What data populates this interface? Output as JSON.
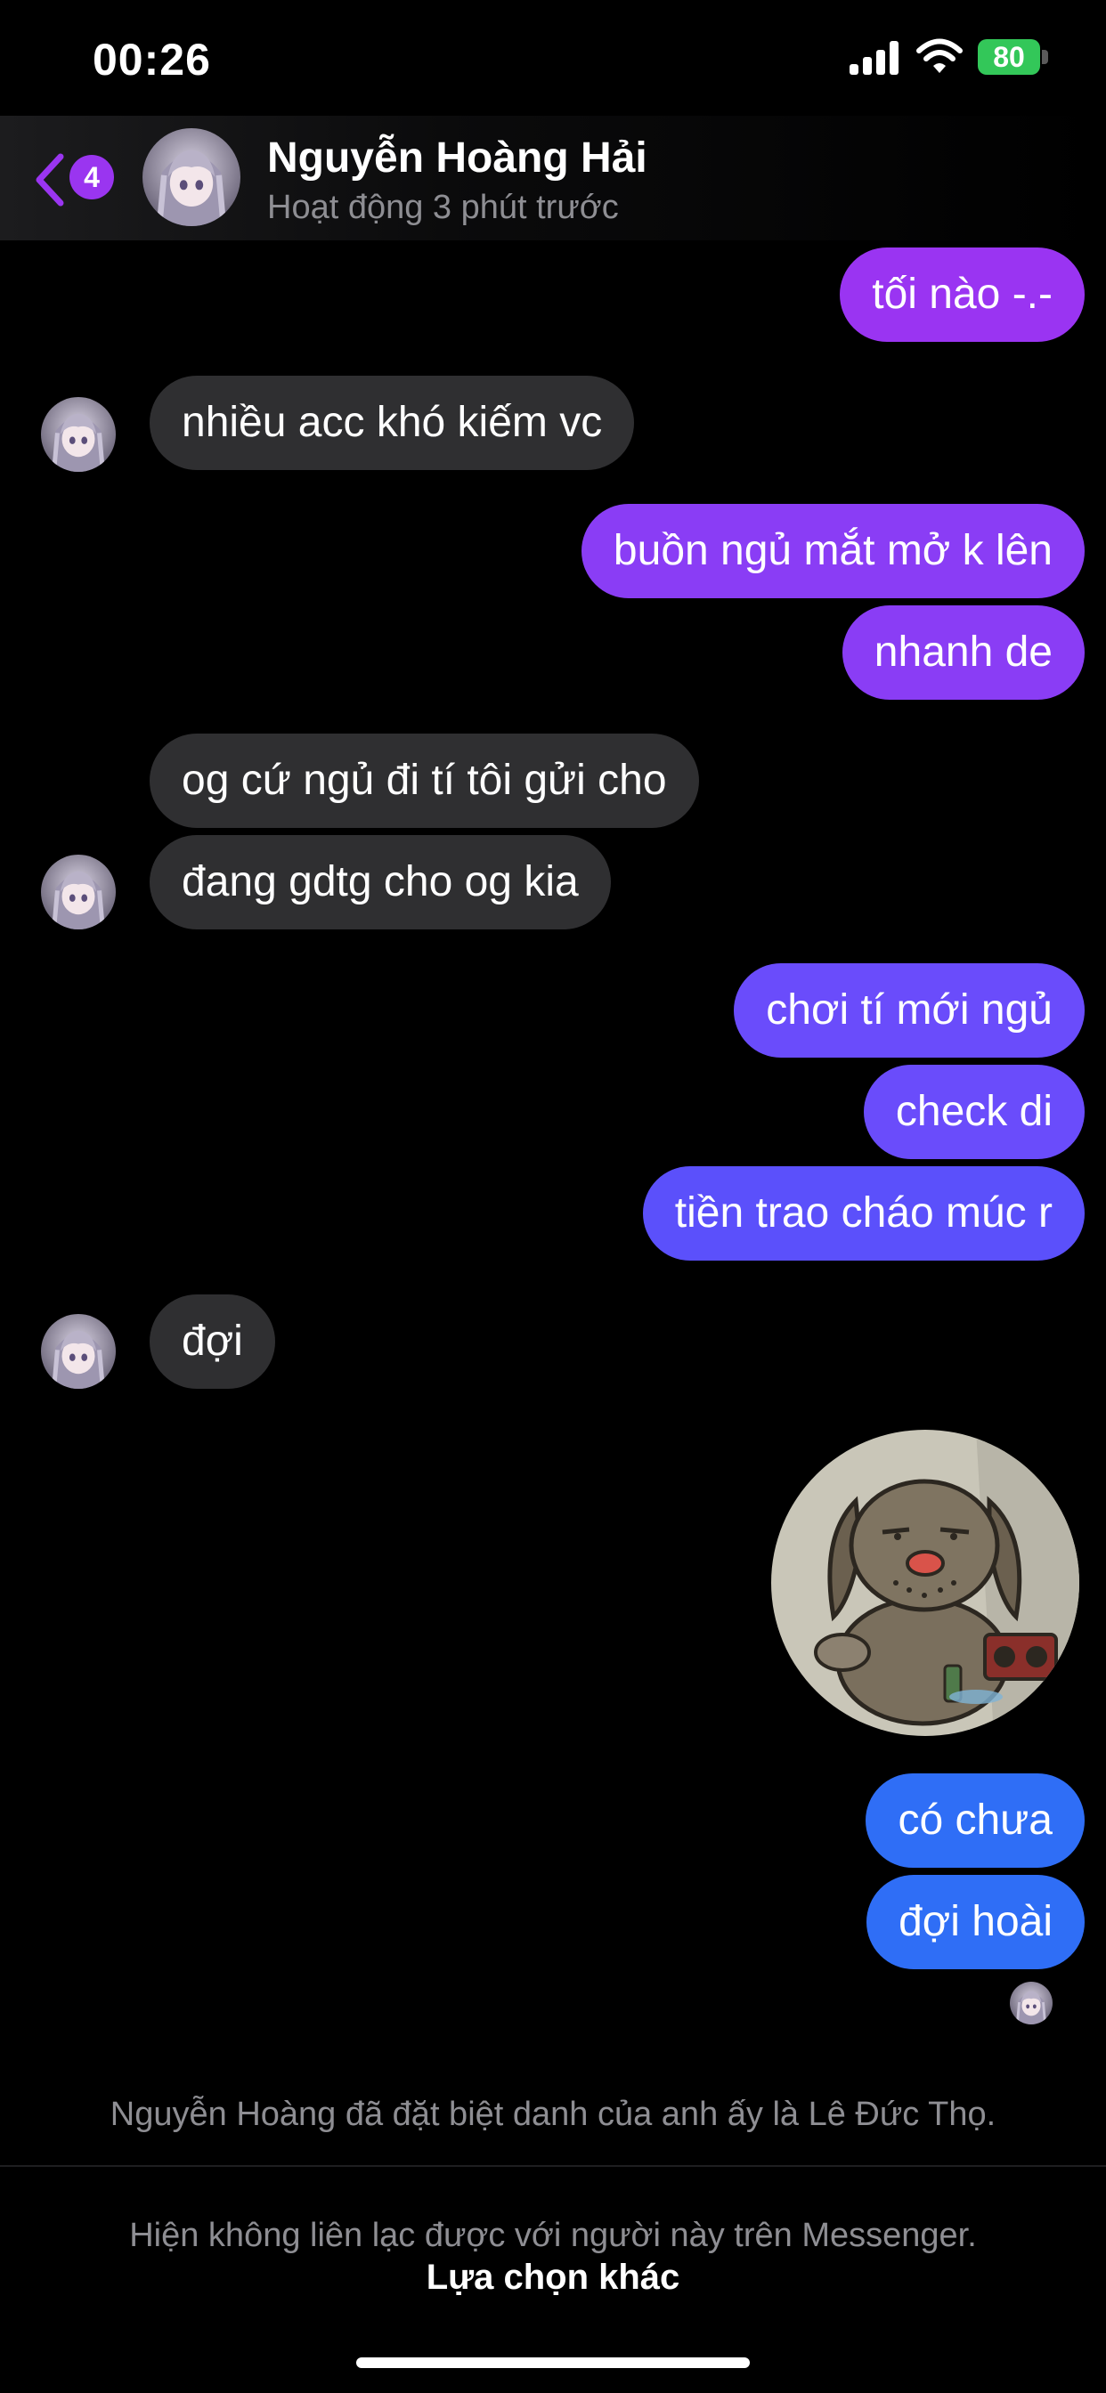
{
  "status_bar": {
    "time": "00:26",
    "battery_percent": "80"
  },
  "header": {
    "unread_count": "4",
    "contact_name": "Nguyễn Hoàng Hải",
    "activity_status": "Hoạt động 3 phút trước"
  },
  "messages": [
    {
      "direction": "outgoing",
      "text": "tối nào -.-",
      "color": "#9a34f2"
    },
    {
      "direction": "incoming",
      "text": "nhiều acc khó kiếm vc",
      "color": "#2f2f31"
    },
    {
      "direction": "outgoing",
      "text": "buồn ngủ mắt mở k lên",
      "color": "#8a3df5"
    },
    {
      "direction": "outgoing",
      "text": "nhanh de",
      "color": "#8a3df5"
    },
    {
      "direction": "incoming",
      "text": "og cứ ngủ đi tí tôi gửi cho",
      "color": "#2f2f31"
    },
    {
      "direction": "incoming",
      "text": "đang gdtg cho og kia",
      "color": "#2f2f31"
    },
    {
      "direction": "outgoing",
      "text": "chơi tí mới ngủ",
      "color": "#6a4cfb"
    },
    {
      "direction": "outgoing",
      "text": "check di",
      "color": "#6a4cfb"
    },
    {
      "direction": "outgoing",
      "text": "tiền trao cháo múc r",
      "color": "#5b50fb"
    },
    {
      "direction": "incoming",
      "text": "đợi",
      "color": "#2f2f31"
    },
    {
      "direction": "outgoing",
      "type": "sticker",
      "icon": "sad-dog-sticker"
    },
    {
      "direction": "outgoing",
      "text": "có chưa",
      "color": "#2f6ef6"
    },
    {
      "direction": "outgoing",
      "text": "đợi hoài",
      "color": "#2f6ef6"
    }
  ],
  "nickname_notice": "Nguyễn Hoàng đã đặt biệt danh của anh ấy là Lê Đức Thọ.",
  "footer": {
    "unavailable_text": "Hiện không liên lạc được với người này trên Messenger.",
    "option_label": "Lựa chọn khác"
  }
}
